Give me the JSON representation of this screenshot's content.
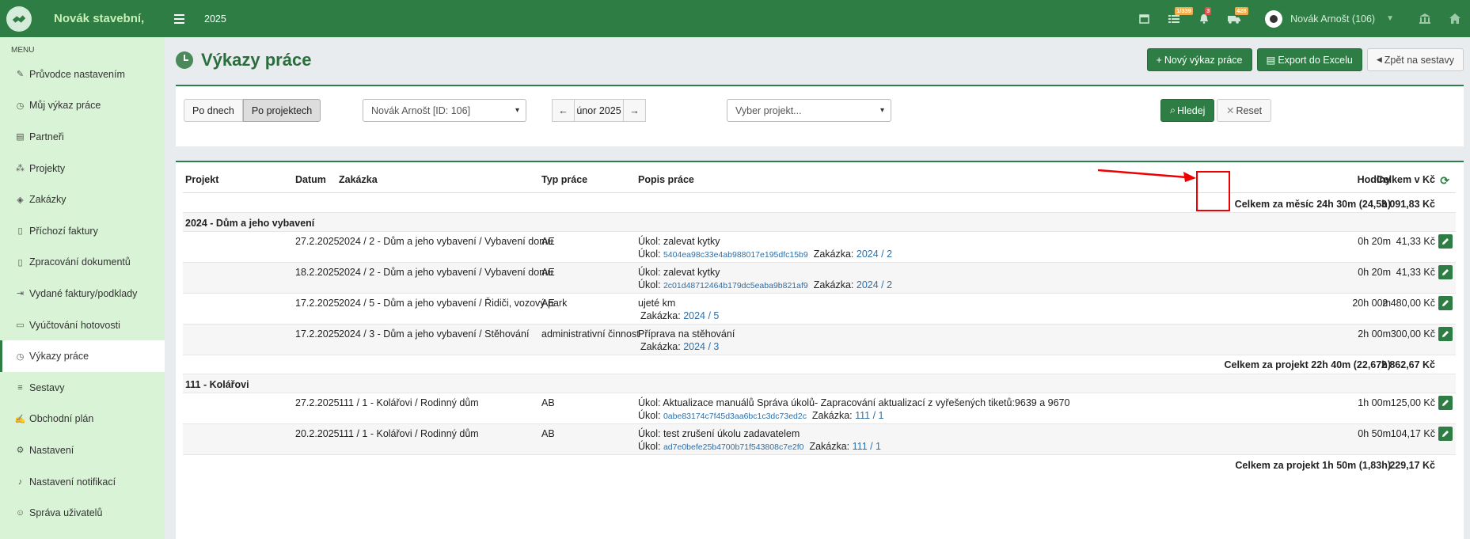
{
  "app": {
    "name": "Novák stavební,",
    "year": "2025"
  },
  "topbar": {
    "badges": {
      "tasks": "1/339",
      "notifications": "3",
      "trucks": "428"
    },
    "user": "Novák Arnošt (106)"
  },
  "sidebar": {
    "title": "MENU",
    "items": [
      {
        "label": "Průvodce nastavením",
        "icon": "pencil-icon"
      },
      {
        "label": "Můj výkaz práce",
        "icon": "clock-icon"
      },
      {
        "label": "Partneři",
        "icon": "building-icon"
      },
      {
        "label": "Projekty",
        "icon": "cubes-icon"
      },
      {
        "label": "Zakázky",
        "icon": "cube-icon"
      },
      {
        "label": "Příchozí faktury",
        "icon": "file-icon"
      },
      {
        "label": "Zpracování dokumentů",
        "icon": "file-icon"
      },
      {
        "label": "Vydané faktury/podklady",
        "icon": "file-export-icon"
      },
      {
        "label": "Vyúčtování hotovosti",
        "icon": "money-icon"
      },
      {
        "label": "Výkazy práce",
        "icon": "clock-icon",
        "active": true
      },
      {
        "label": "Sestavy",
        "icon": "chart-icon"
      },
      {
        "label": "Obchodní plán",
        "icon": "handshake-icon"
      },
      {
        "label": "Nastavení",
        "icon": "cogs-icon"
      },
      {
        "label": "Nastavení notifikací",
        "icon": "bell-icon"
      },
      {
        "label": "Správa uživatelů",
        "icon": "users-icon"
      }
    ]
  },
  "page": {
    "title": "Výkazy práce",
    "buttons": {
      "new": "Nový výkaz práce",
      "export": "Export do Excelu",
      "back": "Zpět na sestavy"
    }
  },
  "filters": {
    "view_days": "Po dnech",
    "view_projects": "Po projektech",
    "user_select": "Novák Arnošt [ID: 106]",
    "month": "únor 2025",
    "project_placeholder": "Vyber projekt...",
    "search": "Hledej",
    "reset": "Reset"
  },
  "table": {
    "headers": {
      "projekt": "Projekt",
      "datum": "Datum",
      "zakazka": "Zakázka",
      "typ": "Typ práce",
      "popis": "Popis práce",
      "hodiny": "Hodiny",
      "celkem": "Celkem v Kč"
    },
    "month_total": {
      "label": "Celkem za měsíc 24h 30m (24,5h)",
      "value": "3 091,83 Kč"
    },
    "groups": [
      {
        "name": "2024 - Dům a jeho vybavení",
        "rows": [
          {
            "datum": "27.2.2025",
            "zakazka": "2024 / 2 - Dům a jeho vybavení / Vybavení domu",
            "typ": "AE",
            "popis": "Úkol: zalevat kytky",
            "ukol_label": "Úkol:",
            "ukol_id": "5404ea98c33e4ab988017e195dfc15b9",
            "zak_label": "Zakázka:",
            "zak_link": "2024 / 2",
            "hodiny": "0h 20m",
            "kc": "41,33 Kč"
          },
          {
            "datum": "18.2.2025",
            "zakazka": "2024 / 2 - Dům a jeho vybavení / Vybavení domu",
            "typ": "AE",
            "popis": "Úkol: zalevat kytky",
            "ukol_label": "Úkol:",
            "ukol_id": "2c01d48712464b179dc5eaba9b821af9",
            "zak_label": "Zakázka:",
            "zak_link": "2024 / 2",
            "hodiny": "0h 20m",
            "kc": "41,33 Kč"
          },
          {
            "datum": "17.2.2025",
            "zakazka": "2024 / 5 - Dům a jeho vybavení / Řidiči, vozový park",
            "typ": "AE",
            "popis": "ujeté km",
            "ukol_label": "",
            "ukol_id": "",
            "zak_label": "Zakázka:",
            "zak_link": "2024 / 5",
            "hodiny": "20h 00m",
            "kc": "2 480,00 Kč"
          },
          {
            "datum": "17.2.2025",
            "zakazka": "2024 / 3 - Dům a jeho vybavení / Stěhování",
            "typ": "administrativní činnost",
            "popis": "Příprava na stěhování",
            "ukol_label": "",
            "ukol_id": "",
            "zak_label": "Zakázka:",
            "zak_link": "2024 / 3",
            "hodiny": "2h 00m",
            "kc": "300,00 Kč"
          }
        ],
        "total": {
          "label": "Celkem za projekt 22h 40m (22,67h)",
          "value": "2 862,67 Kč"
        }
      },
      {
        "name": "111 - Kolářovi",
        "rows": [
          {
            "datum": "27.2.2025",
            "zakazka": "111 / 1 - Kolářovi / Rodinný dům",
            "typ": "AB",
            "popis": "Úkol: Aktualizace manuálů Správa úkolů- Zapracování aktualizací z vyřešených tiketů:9639 a 9670",
            "ukol_label": "Úkol:",
            "ukol_id": "0abe83174c7f45d3aa6bc1c3dc73ed2c",
            "zak_label": "Zakázka:",
            "zak_link": "111 / 1",
            "hodiny": "1h 00m",
            "kc": "125,00 Kč"
          },
          {
            "datum": "20.2.2025",
            "zakazka": "111 / 1 - Kolářovi / Rodinný dům",
            "typ": "AB",
            "popis": "Úkol: test zrušení úkolu zadavatelem",
            "ukol_label": "Úkol:",
            "ukol_id": "ad7e0befe25b4700b71f543808c7e2f0",
            "zak_label": "Zakázka:",
            "zak_link": "111 / 1",
            "hodiny": "0h 50m",
            "kc": "104,17 Kč"
          }
        ],
        "total": {
          "label": "Celkem za projekt 1h 50m (1,83h)",
          "value": "229,17 Kč"
        }
      }
    ]
  },
  "colors": {
    "primary": "#2e7d45",
    "sidebar_bg": "#d8f3d5",
    "link": "#2e6fa7",
    "annotation": "#ee0000"
  }
}
